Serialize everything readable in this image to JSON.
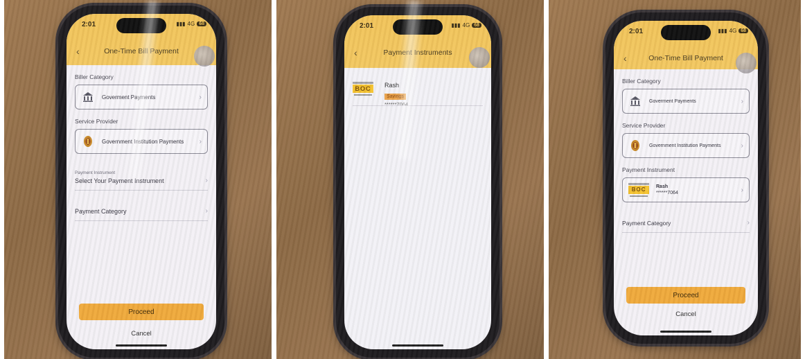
{
  "status": {
    "time": "2:01",
    "network": "4G",
    "battery": "68"
  },
  "screen1": {
    "title": "One-Time Bill Payment",
    "biller_category_label": "Biller Category",
    "biller_category_value": "Goverment Payments",
    "service_provider_label": "Service Provider",
    "service_provider_value": "Government Institution Payments",
    "payment_instrument_small": "Payment Instrument",
    "payment_instrument_placeholder": "Select Your Payment Instrument",
    "payment_category": "Payment Category",
    "proceed": "Proceed",
    "cancel": "Cancel"
  },
  "screen2": {
    "title": "Payment Instruments",
    "account_name": "Rash",
    "account_type": "Savings",
    "account_number": "******7064",
    "bank_logo_text": "BOC"
  },
  "screen3": {
    "title": "One-Time Bill Payment",
    "biller_category_label": "Biller Category",
    "biller_category_value": "Goverment Payments",
    "service_provider_label": "Service Provider",
    "service_provider_value": "Government Institution Payments",
    "payment_instrument_label": "Payment Instrument",
    "account_name": "Rash",
    "account_number": "******7064",
    "bank_logo_text": "BOC",
    "payment_category": "Payment Category",
    "proceed": "Proceed",
    "cancel": "Cancel"
  },
  "colors": {
    "header": "#f2c45a",
    "proceed": "#f0aa3c",
    "screen_bg": "#f4f1f6"
  },
  "icons": {
    "back": "chevron-left-icon",
    "chevron": "chevron-right-icon",
    "bank": "bank-building-icon",
    "emblem": "national-emblem-icon"
  }
}
